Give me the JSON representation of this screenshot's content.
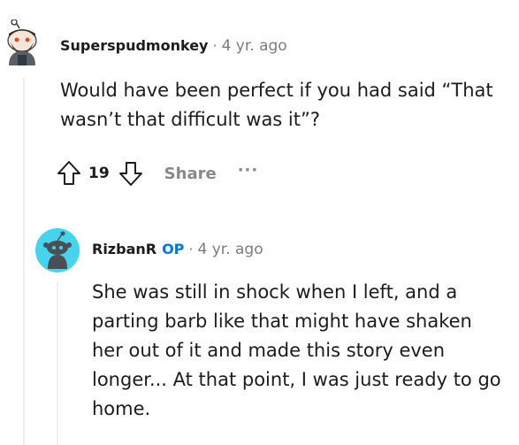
{
  "comments": [
    {
      "author": "Superspudmonkey",
      "separator": "·",
      "time": "4 yr. ago",
      "body": "Would have been perfect if you had said “That wasn’t that difficult was it”?",
      "score": "19",
      "share_label": "Share",
      "more_label": "···"
    },
    {
      "author": "RizbanR",
      "badge": "OP",
      "separator": "·",
      "time": "4 yr. ago",
      "body": "She was still in shock when I left, and a parting barb like that might have shaken her out of it and made this story even longer... At that point, I was just ready to go home."
    }
  ],
  "colors": {
    "op_badge": "#0079d3",
    "meta_gray": "#7c7c7c",
    "action_gray": "#878a8c",
    "avatar2_bg": "#46d3ee"
  },
  "icons": {
    "avatar1": "user-avatar-snoo-bearded",
    "upvote": "arrow-up-outline-icon",
    "downvote": "arrow-down-outline-icon",
    "avatar2": "user-avatar-snoo-default"
  }
}
